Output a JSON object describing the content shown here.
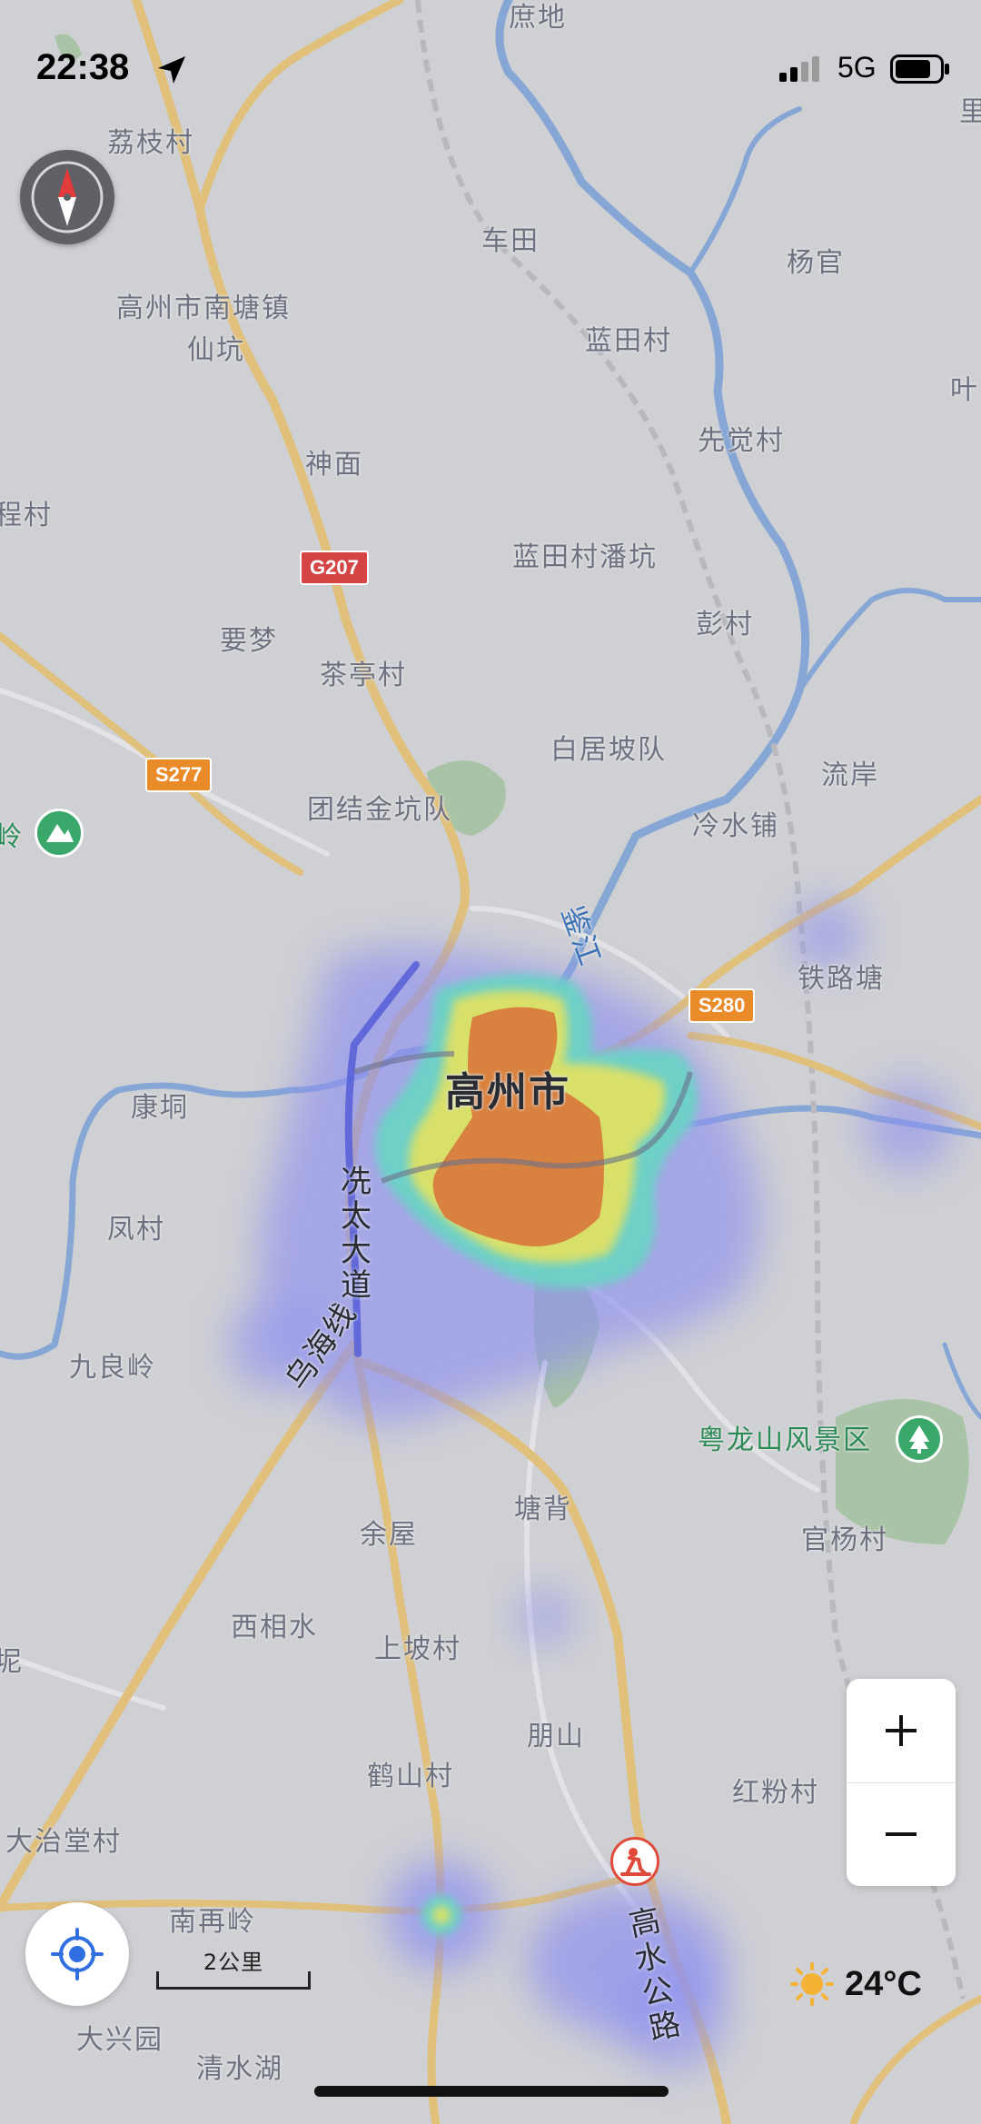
{
  "status_bar": {
    "time": "22:38",
    "network": "5G"
  },
  "map": {
    "city_name": "高州市",
    "river_label": "鉴江",
    "road_vertical_label": [
      "冼",
      "太",
      "大",
      "道"
    ],
    "road_diag_label": "乌海线",
    "road_gaoshui_label": [
      "高",
      "水",
      "公",
      "路"
    ],
    "shields": [
      "G207",
      "S277",
      "S280"
    ],
    "places": {
      "top_partial": "庶地",
      "lizhi": "荔枝村",
      "chetian": "车田",
      "yangguan": "杨官",
      "nantang": "高州市南塘镇",
      "xiankeng": "仙坑",
      "lantian": "蓝田村",
      "xianjue": "先觉村",
      "shenmian": "神面",
      "cheng": "程村",
      "lantian_pankeng": "蓝田村潘坑",
      "pengcun": "彭村",
      "yaomeng": "要梦",
      "chating": "茶亭村",
      "baiju": "白居坡队",
      "liuan": "流岸",
      "tuanjie": "团结金坑队",
      "lengshui": "冷水铺",
      "ling_partial": "岭",
      "tielu": "铁路塘",
      "kangdong": "康垌",
      "fengcun": "凤村",
      "jiuliang": "九良岭",
      "yuelong": "粤龙山风景区",
      "tangbei": "塘背",
      "yuwu": "余屋",
      "guanyang": "官杨村",
      "xixiangshui": "西相水",
      "shangpo": "上坡村",
      "ni_partial": "坭",
      "pengshan": "朋山",
      "heshan": "鹤山村",
      "hongfen": "红粉村",
      "dazhitang": "大治堂村",
      "nanzailing": "南再岭",
      "daxingyuan": "大兴园",
      "qingshuihu": "清水湖",
      "right_li": "里",
      "right_ye": "叶"
    }
  },
  "scale": {
    "label": "2公里"
  },
  "weather": {
    "temperature": "24°C",
    "icon": "sun-icon"
  },
  "controls": {
    "zoom_in": "+",
    "zoom_out": "−"
  },
  "colors": {
    "heat_core": "#d9823f",
    "heat_mid": "#d8e06a",
    "heat_outer": "#4cc5c9",
    "heat_halo": "#8e90f0",
    "river": "#86a6d6",
    "road": "#e0c07a"
  }
}
